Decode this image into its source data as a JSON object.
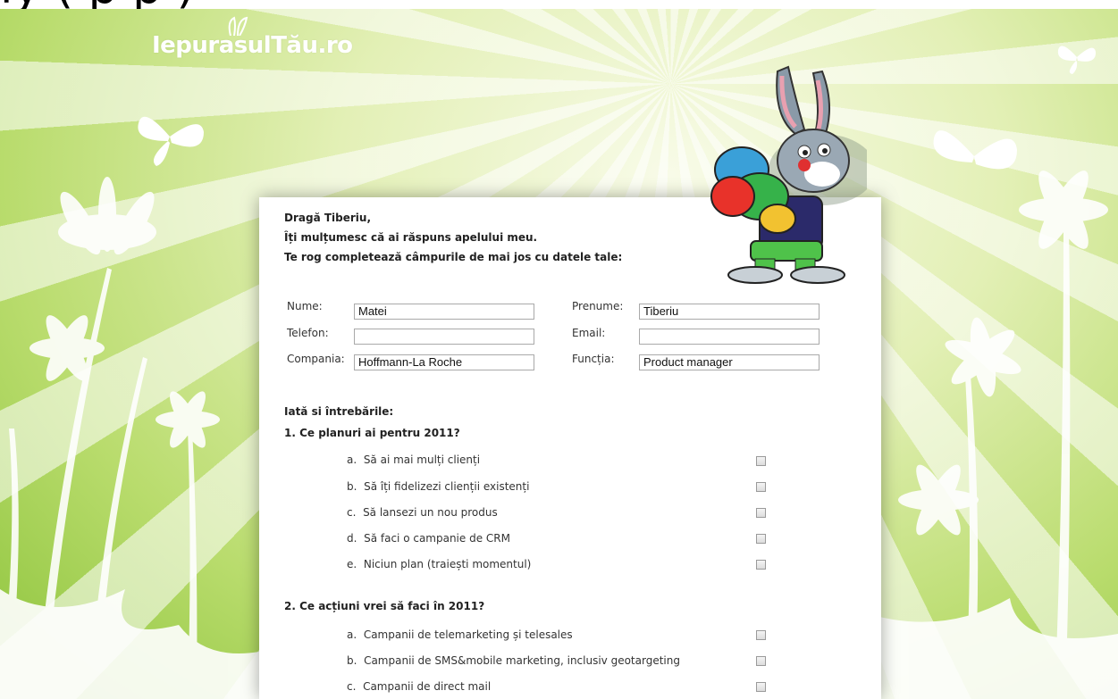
{
  "top_fragment": "ly  (     p    p )",
  "logo": "IepurasulTău.ro",
  "intro": [
    "Dragă Tiberiu,",
    "Îți mulțumesc că ai răspuns apelului meu.",
    "Te rog completează câmpurile de mai jos cu datele tale:"
  ],
  "form": {
    "nume_label": "Nume:",
    "nume_value": "Matei",
    "prenume_label": "Prenume:",
    "prenume_value": "Tiberiu",
    "telefon_label": "Telefon:",
    "telefon_value": "",
    "email_label": "Email:",
    "email_value": "",
    "compania_label": "Compania:",
    "compania_value": "Hoffmann-La Roche",
    "functia_label": "Funcția:",
    "functia_value": "Product manager"
  },
  "questions_heading": "Iată si întrebările:",
  "q1": {
    "title": "1. Ce planuri ai pentru 2011?",
    "options": [
      {
        "letter": "a.",
        "text": "Să ai mai mulți clienți"
      },
      {
        "letter": "b.",
        "text": "Să îți fidelizezi clienții existenți"
      },
      {
        "letter": "c.",
        "text": "Să lansezi un nou produs"
      },
      {
        "letter": "d.",
        "text": "Să faci o campanie de CRM"
      },
      {
        "letter": "e.",
        "text": "Niciun plan (traiești momentul)"
      }
    ]
  },
  "q2": {
    "title": "2. Ce acțiuni vrei să faci în 2011?",
    "options": [
      {
        "letter": "a.",
        "text": "Campanii de telemarketing și telesales"
      },
      {
        "letter": "b.",
        "text": "Campanii de SMS&mobile marketing, inclusiv geotargeting"
      },
      {
        "letter": "c.",
        "text": "Campanii de direct mail"
      }
    ]
  },
  "colors": {
    "background_green": "#a9d25a",
    "card": "#ffffff"
  }
}
